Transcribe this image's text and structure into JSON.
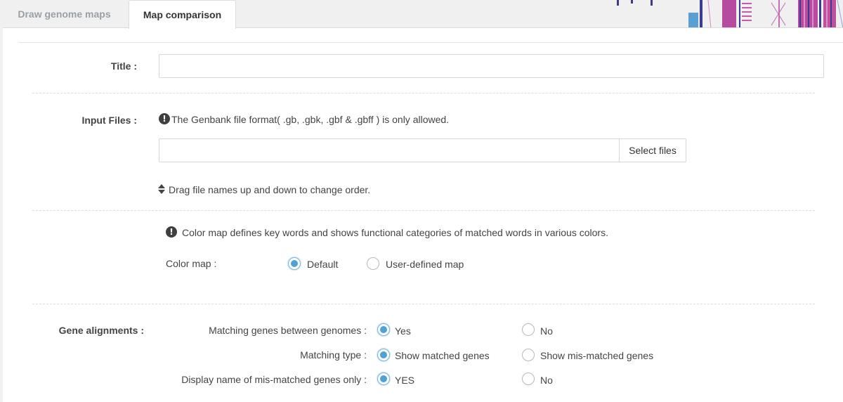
{
  "tabs": [
    {
      "label": "Draw genome maps",
      "active": false
    },
    {
      "label": "Map comparison",
      "active": true
    }
  ],
  "form": {
    "title_label": "Title :",
    "title_value": "",
    "input_files_label": "Input Files :",
    "input_files_note": "The Genbank file format( .gb, .gbk, .gbf & .gbff ) is only allowed.",
    "file_path_value": "",
    "select_files_label": "Select files",
    "drag_hint": "Drag file names up and down to change order.",
    "color_map_note": "Color map defines key words and shows functional categories of matched words in various colors.",
    "color_map_label": "Color map :",
    "color_map_options": [
      "Default",
      "User-defined map"
    ],
    "color_map_selected": "Default",
    "gene_alignments_label": "Gene alignments :",
    "gene_rows": [
      {
        "label": "Matching genes between genomes :",
        "options": [
          "Yes",
          "No"
        ],
        "selected": "Yes"
      },
      {
        "label": "Matching type :",
        "options": [
          "Show matched genes",
          "Show mis-matched genes"
        ],
        "selected": "Show matched genes"
      },
      {
        "label": "Display name of mis-matched genes only :",
        "options": [
          "YES",
          "No"
        ],
        "selected": "YES"
      }
    ]
  },
  "colors": {
    "accent": "#4da2d8",
    "banner_purple": "#3b3b8f",
    "banner_magenta": "#b64ba0",
    "banner_pink": "#e08fc8",
    "banner_blue": "#5a9fd4",
    "banner_yellow": "#e8c840"
  },
  "icons": [
    "info-circle-icon",
    "sort-icon"
  ]
}
